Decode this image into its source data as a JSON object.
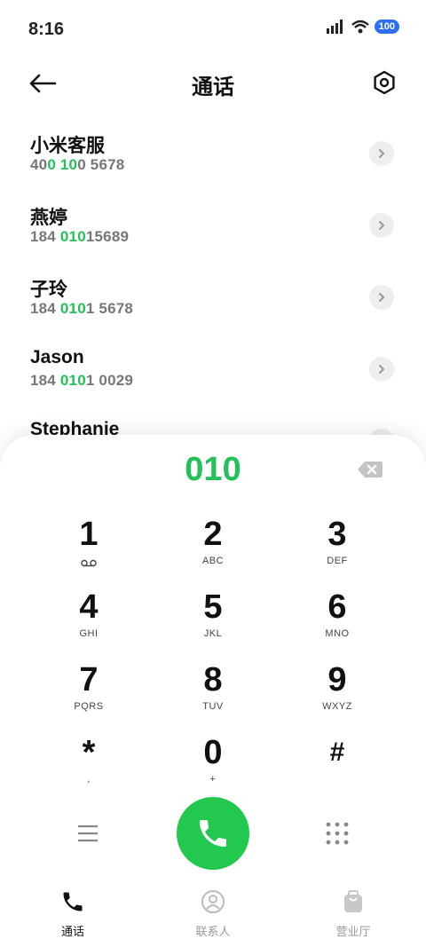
{
  "status_bar": {
    "time": "8:16",
    "battery": "100"
  },
  "header": {
    "title": "通话"
  },
  "contacts": [
    {
      "name": "小米客服",
      "number": [
        [
          "40",
          false
        ],
        [
          "0",
          true
        ],
        [
          " ",
          false
        ],
        [
          "10",
          true
        ],
        [
          "0 5678",
          false
        ]
      ]
    },
    {
      "name": "燕婷",
      "number": [
        [
          "184 ",
          false
        ],
        [
          "010",
          true
        ],
        [
          "15689",
          false
        ]
      ]
    },
    {
      "name": "子玲",
      "number": [
        [
          "184 ",
          false
        ],
        [
          "010",
          true
        ],
        [
          "1 5678",
          false
        ]
      ]
    },
    {
      "name": "Jason",
      "number": [
        [
          "184 ",
          false
        ],
        [
          "010",
          true
        ],
        [
          "1 0029",
          false
        ]
      ]
    },
    {
      "name": "Stephanie",
      "number": []
    }
  ],
  "dialpad": {
    "input": "010",
    "keys": [
      {
        "digit": "1",
        "letters": ""
      },
      {
        "digit": "2",
        "letters": "ABC"
      },
      {
        "digit": "3",
        "letters": "DEF"
      },
      {
        "digit": "4",
        "letters": "GHI"
      },
      {
        "digit": "5",
        "letters": "JKL"
      },
      {
        "digit": "6",
        "letters": "MNO"
      },
      {
        "digit": "7",
        "letters": "PQRS"
      },
      {
        "digit": "8",
        "letters": "TUV"
      },
      {
        "digit": "9",
        "letters": "WXYZ"
      },
      {
        "digit": "*",
        "letters": ","
      },
      {
        "digit": "0",
        "letters": "+"
      },
      {
        "digit": "#",
        "letters": ""
      }
    ]
  },
  "tabs": [
    {
      "label": "通话",
      "icon": "phone-icon",
      "active": true
    },
    {
      "label": "联系人",
      "icon": "person-icon",
      "active": false
    },
    {
      "label": "营业厅",
      "icon": "bag-icon",
      "active": false
    }
  ],
  "colors": {
    "accent": "#22c15a",
    "call_button": "#22c94e",
    "battery": "#2f6ef7"
  }
}
